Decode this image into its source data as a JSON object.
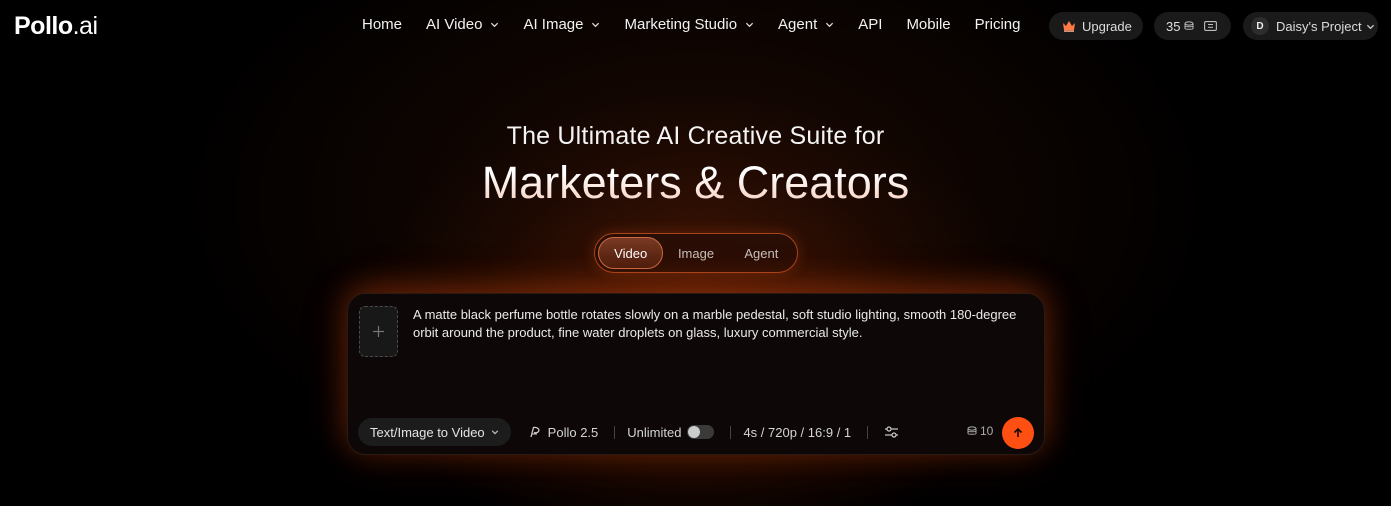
{
  "brand": {
    "logo_main": "Pollo",
    "logo_suffix": ".ai"
  },
  "nav": {
    "items": [
      {
        "label": "Home",
        "has_dropdown": false
      },
      {
        "label": "AI Video",
        "has_dropdown": true
      },
      {
        "label": "AI Image",
        "has_dropdown": true
      },
      {
        "label": "Marketing Studio",
        "has_dropdown": true
      },
      {
        "label": "Agent",
        "has_dropdown": true
      },
      {
        "label": "API",
        "has_dropdown": false
      },
      {
        "label": "Mobile",
        "has_dropdown": false
      },
      {
        "label": "Pricing",
        "has_dropdown": false
      }
    ],
    "upgrade_label": "Upgrade",
    "credits": "35",
    "project_initial": "D",
    "project_name": "Daisy's Project"
  },
  "hero": {
    "subtitle": "The Ultimate AI Creative Suite for",
    "title": "Marketers & Creators"
  },
  "tabs": [
    {
      "label": "Video",
      "active": true
    },
    {
      "label": "Image",
      "active": false
    },
    {
      "label": "Agent",
      "active": false
    }
  ],
  "prompt": {
    "text": "A matte black perfume bottle rotates slowly on a marble pedestal, soft studio lighting, smooth 180-degree orbit around the product, fine water droplets on glass, luxury commercial style.",
    "mode_label": "Text/Image to Video",
    "model_label": "Pollo 2.5",
    "unlimited_label": "Unlimited",
    "unlimited_on": false,
    "settings_label": "4s / 720p / 16:9 / 1",
    "cost": "10"
  },
  "colors": {
    "accent": "#ff4f12",
    "tab_border": "#a8431a",
    "background": "#000000"
  }
}
